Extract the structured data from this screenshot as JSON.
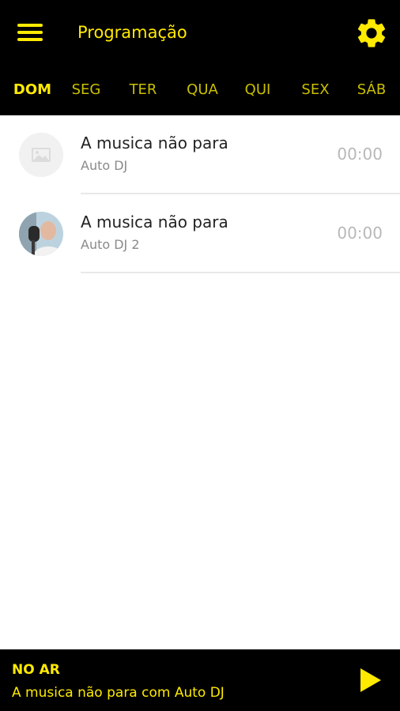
{
  "colors": {
    "accent": "#ffea00",
    "header_bg": "#000000",
    "muted_tab": "#c9c000"
  },
  "header": {
    "menu_icon": "hamburger-menu-icon",
    "title": "Programação",
    "settings_icon": "gear-icon"
  },
  "tabs": [
    {
      "label": "DOM",
      "active": true
    },
    {
      "label": "SEG",
      "active": false
    },
    {
      "label": "TER",
      "active": false
    },
    {
      "label": "QUA",
      "active": false
    },
    {
      "label": "QUI",
      "active": false
    },
    {
      "label": "SEX",
      "active": false
    },
    {
      "label": "SÁB",
      "active": false
    }
  ],
  "schedule": [
    {
      "title": "A musica não para",
      "host": "Auto DJ",
      "time": "00:00",
      "avatar": "image-placeholder-icon"
    },
    {
      "title": "A musica não para",
      "host": "Auto DJ 2",
      "time": "00:00",
      "avatar": "host-photo"
    }
  ],
  "player": {
    "status_label": "NO AR",
    "now_playing": "A musica não para com Auto DJ",
    "play_icon": "play-icon"
  }
}
